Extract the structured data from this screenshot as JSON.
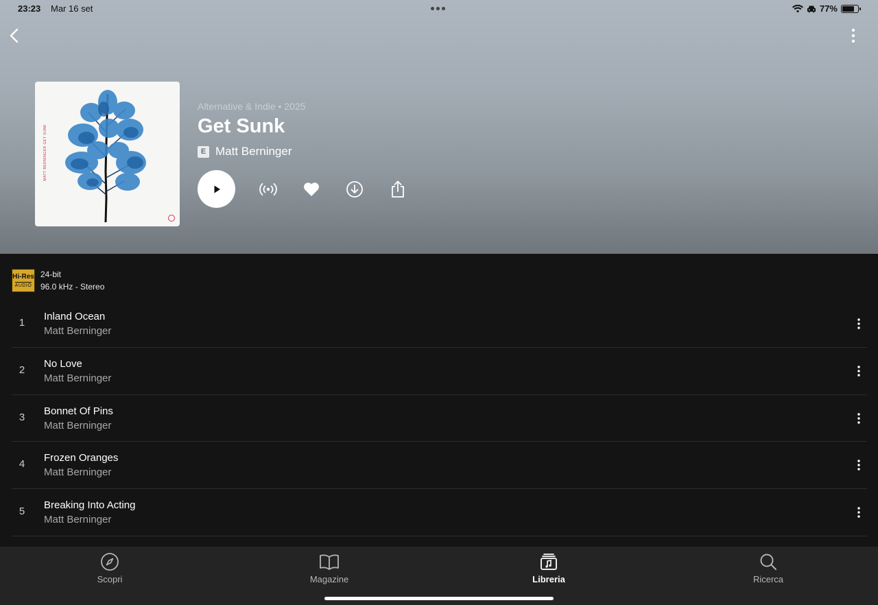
{
  "status_bar": {
    "time": "23:23",
    "date": "Mar 16 set",
    "battery": "77%",
    "battery_level": 0.77
  },
  "header": {
    "back_icon": "chevron-left-icon",
    "more_icon": "vertical-ellipsis-icon"
  },
  "album": {
    "meta": "Alternative & Indie • 2025",
    "title": "Get Sunk",
    "explicit_badge": "E",
    "artist": "Matt Berninger",
    "cover_side_text": "MATT BERNINGER   GET SUNK"
  },
  "actions": [
    {
      "name": "play-icon"
    },
    {
      "name": "radio-icon"
    },
    {
      "name": "heart-icon"
    },
    {
      "name": "download-icon"
    },
    {
      "name": "share-icon"
    }
  ],
  "quality": {
    "badge_top": "Hi-Res",
    "badge_bottom": "AUDIO",
    "line1": "24-bit",
    "line2": "96.0 kHz - Stereo"
  },
  "tracks": [
    {
      "number": "1",
      "title": "Inland Ocean",
      "artist": "Matt Berninger"
    },
    {
      "number": "2",
      "title": "No Love",
      "artist": "Matt Berninger"
    },
    {
      "number": "3",
      "title": "Bonnet Of Pins",
      "artist": "Matt Berninger"
    },
    {
      "number": "4",
      "title": "Frozen Oranges",
      "artist": "Matt Berninger"
    },
    {
      "number": "5",
      "title": "Breaking Into Acting",
      "artist": "Matt Berninger"
    }
  ],
  "tabbar": {
    "tabs": [
      {
        "label": "Scopri",
        "icon": "compass-icon",
        "active": false
      },
      {
        "label": "Magazine",
        "icon": "book-icon",
        "active": false
      },
      {
        "label": "Libreria",
        "icon": "library-icon",
        "active": true
      },
      {
        "label": "Ricerca",
        "icon": "search-icon",
        "active": false
      }
    ]
  },
  "colors": {
    "header_top": "#aeb7bf",
    "background": "#141414",
    "tabbar": "#242424",
    "hires_gold": "#d7a72a"
  }
}
